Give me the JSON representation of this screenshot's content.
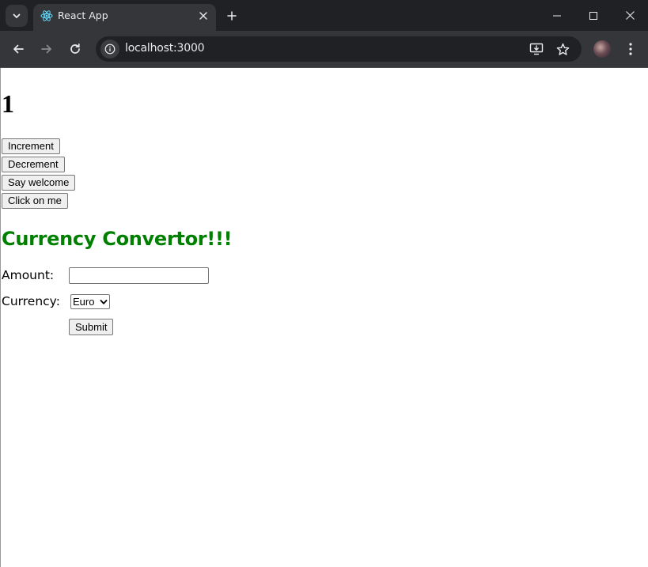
{
  "browser": {
    "tab_title": "React App",
    "url": "localhost:3000",
    "icons": [
      "tab-search-icon",
      "react-favicon-icon",
      "close-icon",
      "new-tab-icon",
      "minimize-icon",
      "maximize-icon",
      "window-close-icon",
      "back-icon",
      "forward-icon",
      "reload-icon",
      "site-info-icon",
      "install-app-icon",
      "star-icon",
      "kebab-menu-icon"
    ],
    "colors": {
      "titlebar": "#202124",
      "toolbar": "#35363a",
      "omnibox": "#202124",
      "text": "#e8eaed"
    }
  },
  "page": {
    "counter": "1",
    "buttons": {
      "increment": "Increment",
      "decrement": "Decrement",
      "say_welcome": "Say welcome",
      "click_on_me": "Click on me"
    },
    "converter": {
      "heading": "Currency Convertor!!!",
      "heading_color": "#008000",
      "amount_label": "Amount:",
      "amount_value": "",
      "currency_label": "Currency:",
      "currency_selected": "Euro",
      "submit_label": "Submit"
    }
  }
}
